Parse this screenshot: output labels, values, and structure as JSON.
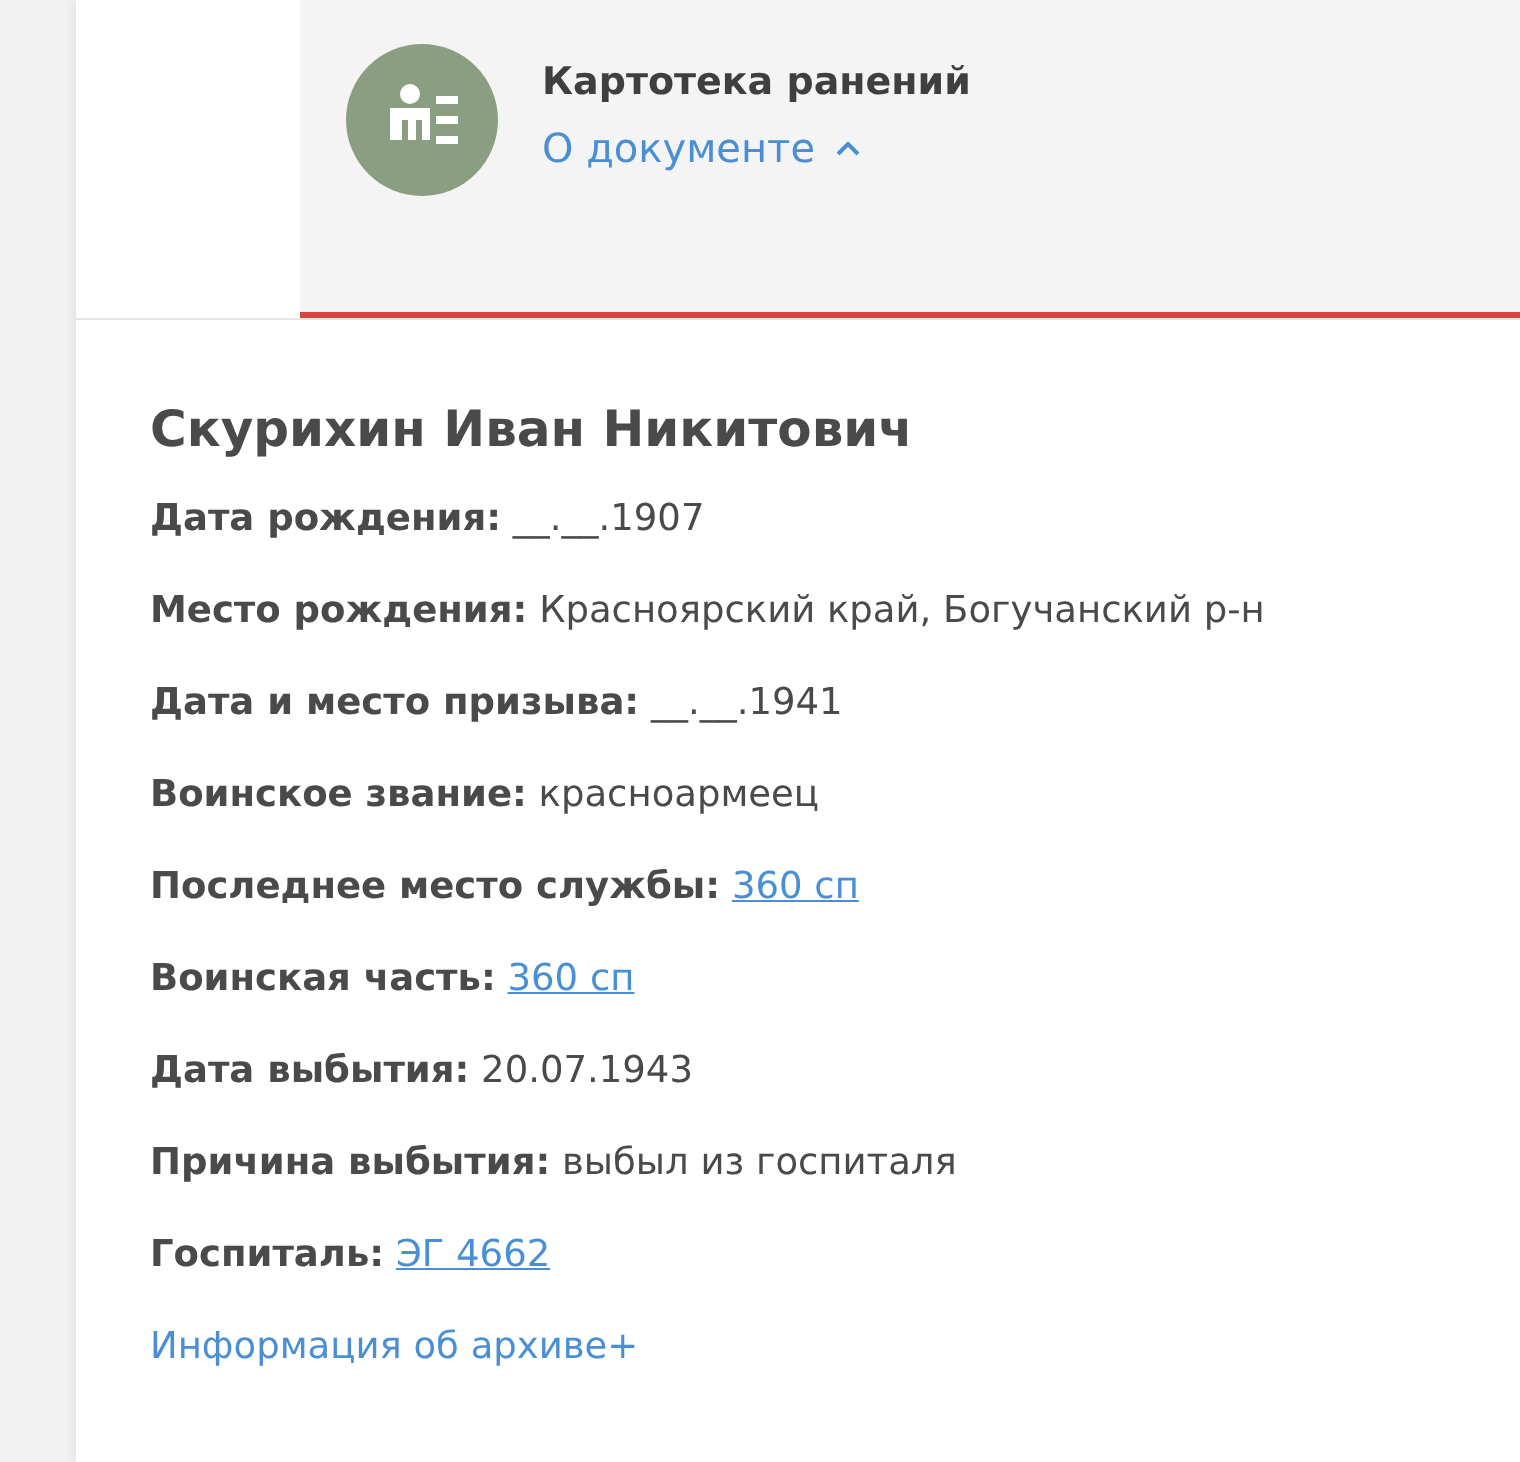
{
  "document": {
    "title": "Картотека ранений",
    "toggle": {
      "label": "О документе",
      "expanded": true
    }
  },
  "person": {
    "name": "Скурихин Иван Никитович",
    "fields": [
      {
        "label": "Дата рождения:",
        "value": "__.__.1907",
        "kind": "text"
      },
      {
        "label": "Место рождения:",
        "value": "Красноярский край, Богучанский р-н",
        "kind": "text"
      },
      {
        "label": "Дата и место призыва:",
        "value": "__.__.1941",
        "kind": "text"
      },
      {
        "label": "Воинское звание:",
        "value": "красноармеец",
        "kind": "text"
      },
      {
        "label": "Последнее место службы:",
        "value": "360 сп",
        "kind": "link"
      },
      {
        "label": "Воинская часть:",
        "value": "360 сп",
        "kind": "link"
      },
      {
        "label": "Дата выбытия:",
        "value": "20.07.1943",
        "kind": "text"
      },
      {
        "label": "Причина выбытия:",
        "value": "выбыл из госпиталя",
        "kind": "text"
      },
      {
        "label": "Госпиталь:",
        "value": "ЭГ 4662",
        "kind": "link"
      }
    ],
    "archive_link": "Информация об архиве+"
  }
}
